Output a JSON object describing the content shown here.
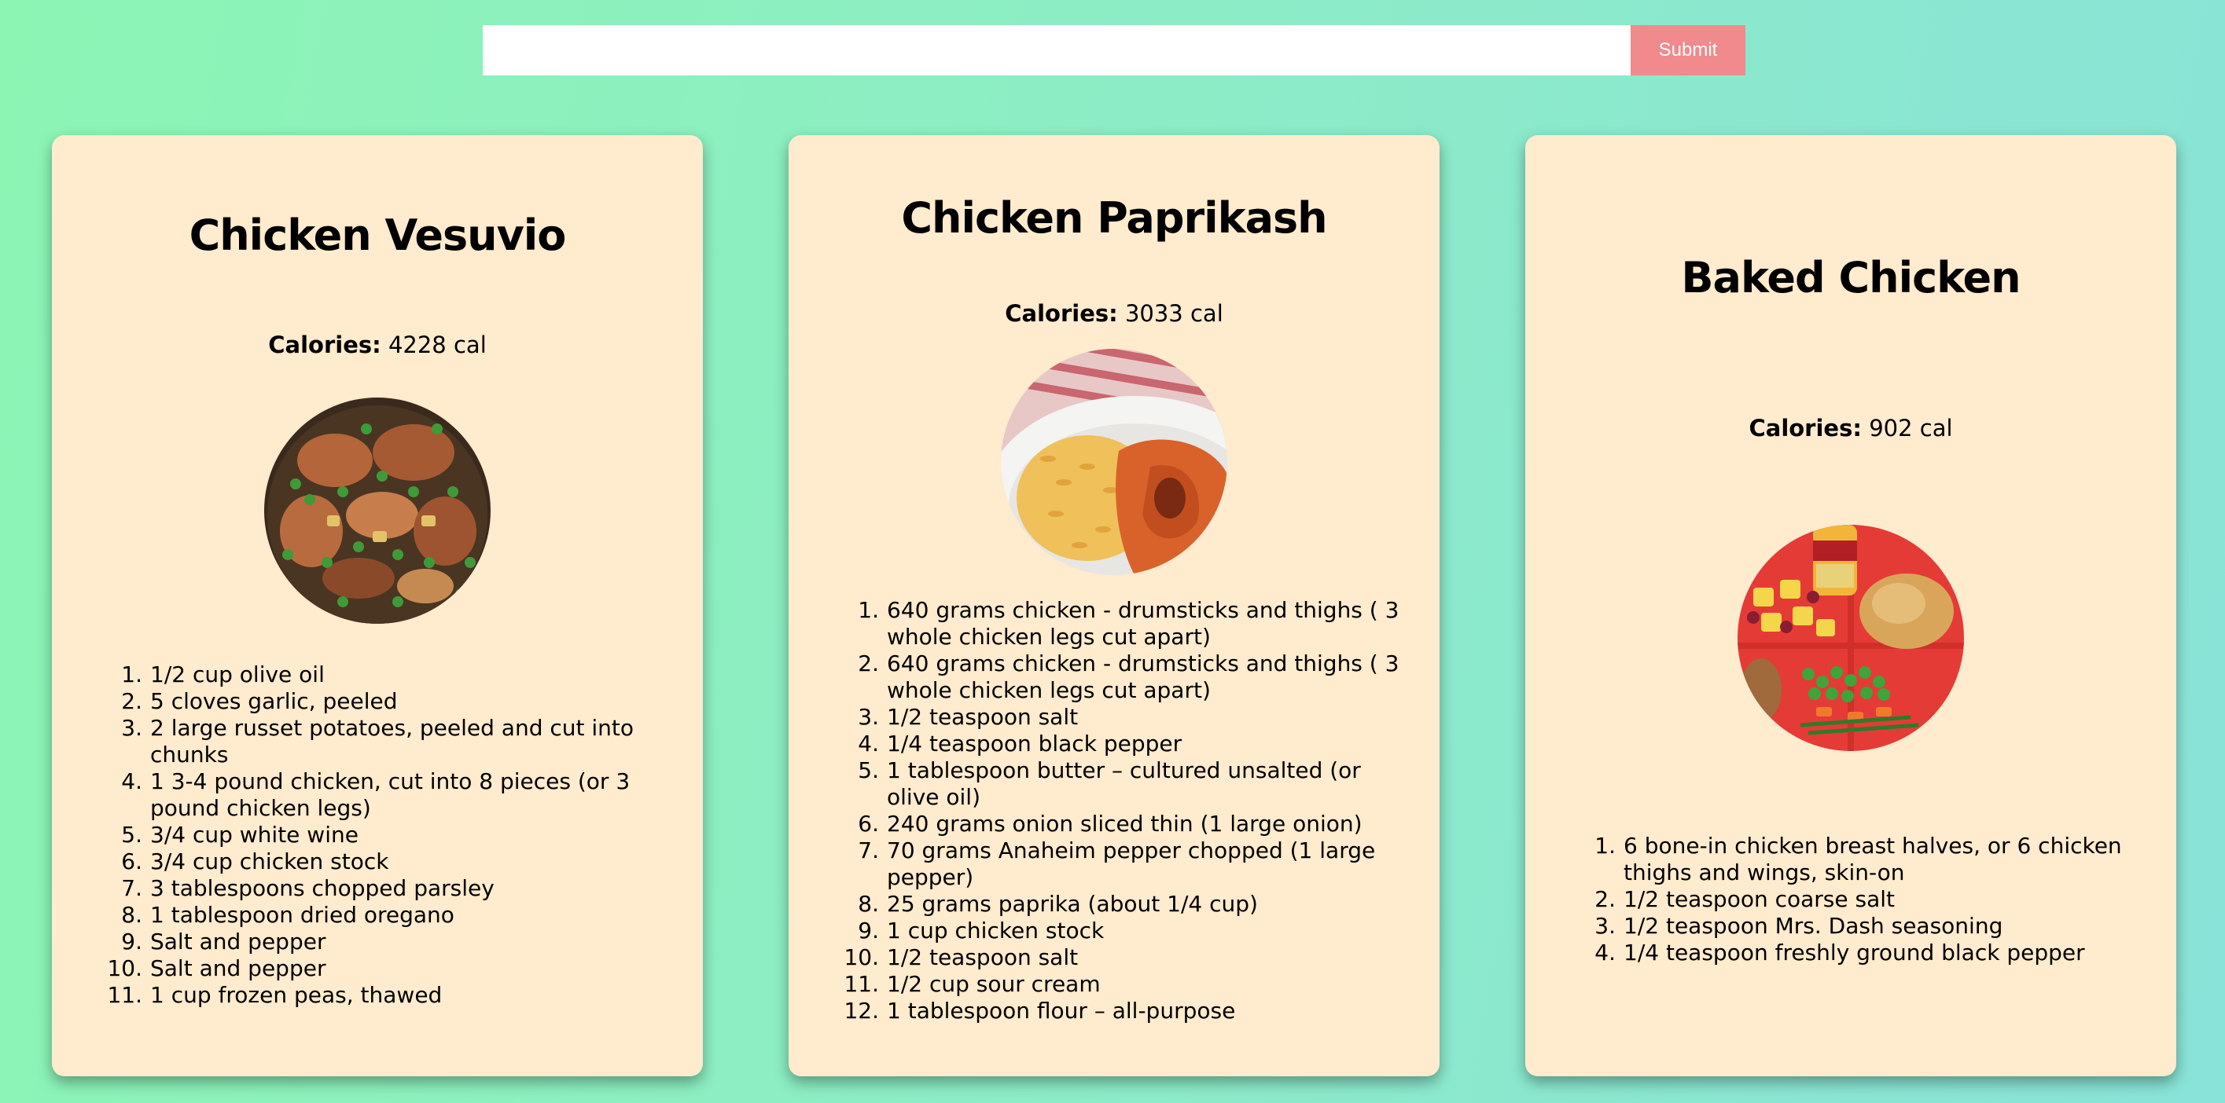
{
  "search": {
    "value": "",
    "placeholder": "",
    "submit_label": "Submit"
  },
  "colors": {
    "background_start": "#8cf5b4",
    "background_end": "#89e3d8",
    "card": "#ffebcd",
    "submit_button": "#f08a8c"
  },
  "recipes": [
    {
      "title": "Chicken Vesuvio",
      "calories_label": "Calories:",
      "calories_value": "4228 cal",
      "image_icon": "chicken-vesuvio-photo",
      "ingredients": [
        "1/2 cup olive oil",
        "5 cloves garlic, peeled",
        "2 large russet potatoes, peeled and cut into chunks",
        "1 3-4 pound chicken, cut into 8 pieces (or 3 pound chicken legs)",
        "3/4 cup white wine",
        "3/4 cup chicken stock",
        "3 tablespoons chopped parsley",
        "1 tablespoon dried oregano",
        "Salt and pepper",
        "Salt and pepper",
        "1 cup frozen peas, thawed"
      ]
    },
    {
      "title": "Chicken Paprikash",
      "calories_label": "Calories:",
      "calories_value": "3033 cal",
      "image_icon": "chicken-paprikash-photo",
      "ingredients": [
        "640 grams chicken - drumsticks and thighs ( 3 whole chicken legs cut apart)",
        "640 grams chicken - drumsticks and thighs ( 3 whole chicken legs cut apart)",
        "1/2 teaspoon salt",
        "1/4 teaspoon black pepper",
        "1 tablespoon butter – cultured unsalted (or olive oil)",
        "240 grams onion sliced thin (1 large onion)",
        "70 grams Anaheim pepper chopped (1 large pepper)",
        "25 grams paprika (about 1/4 cup)",
        "1 cup chicken stock",
        "1/2 teaspoon salt",
        "1/2 cup sour cream",
        "1 tablespoon flour – all-purpose"
      ]
    },
    {
      "title": "Baked Chicken",
      "calories_label": "Calories:",
      "calories_value": "902 cal",
      "image_icon": "baked-chicken-photo",
      "ingredients": [
        "6 bone-in chicken breast halves, or 6 chicken thighs and wings, skin-on",
        "1/2 teaspoon coarse salt",
        "1/2 teaspoon Mrs. Dash seasoning",
        "1/4 teaspoon freshly ground black pepper"
      ]
    }
  ]
}
